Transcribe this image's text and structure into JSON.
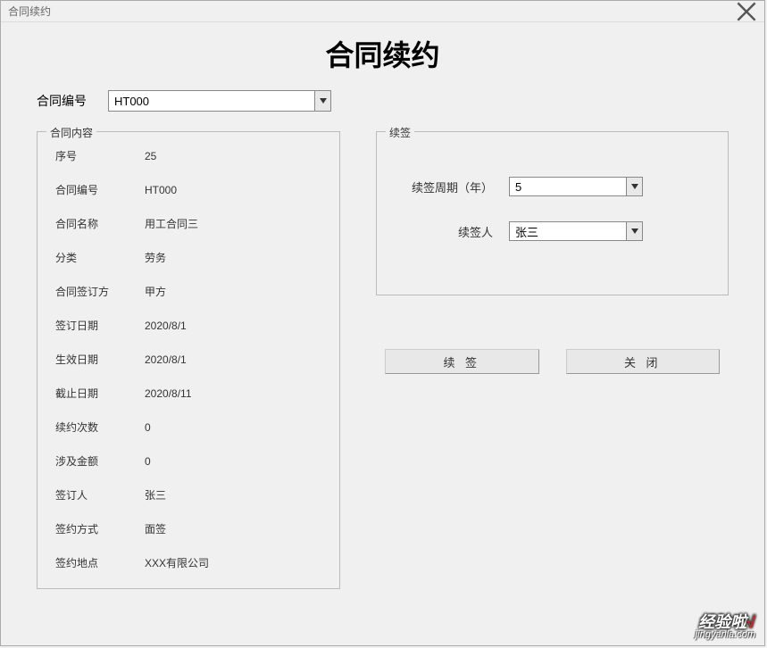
{
  "window": {
    "title": "合同续约"
  },
  "header": {
    "title": "合同续约"
  },
  "top": {
    "label": "合同编号",
    "value": "HT000"
  },
  "content_group": {
    "legend": "合同内容",
    "fields": [
      {
        "label": "序号",
        "value": "25"
      },
      {
        "label": "合同编号",
        "value": "HT000"
      },
      {
        "label": "合同名称",
        "value": "用工合同三"
      },
      {
        "label": "分类",
        "value": "劳务"
      },
      {
        "label": "合同签订方",
        "value": "甲方"
      },
      {
        "label": "签订日期",
        "value": "2020/8/1"
      },
      {
        "label": "生效日期",
        "value": "2020/8/1"
      },
      {
        "label": "截止日期",
        "value": "2020/8/11"
      },
      {
        "label": "续约次数",
        "value": "0"
      },
      {
        "label": "涉及金额",
        "value": "0"
      },
      {
        "label": "签订人",
        "value": "张三"
      },
      {
        "label": "签约方式",
        "value": "面签"
      },
      {
        "label": "签约地点",
        "value": "XXX有限公司"
      }
    ]
  },
  "renew_group": {
    "legend": "续签",
    "period_label": "续签周期（年）",
    "period_value": "5",
    "person_label": "续签人",
    "person_value": "张三"
  },
  "buttons": {
    "renew": "续 签",
    "close": "关 闭"
  },
  "watermark": {
    "top": "经验啦",
    "check": "√",
    "bottom": "jingyanla.com"
  }
}
